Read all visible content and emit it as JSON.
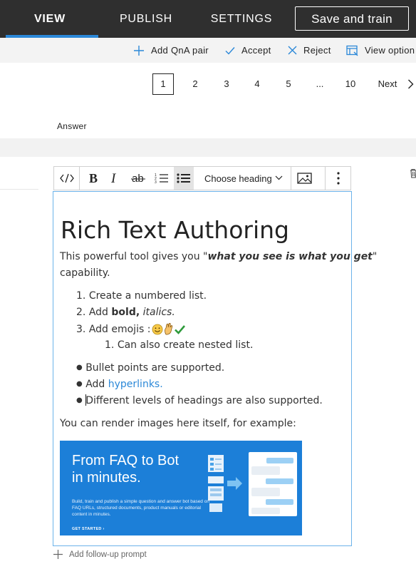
{
  "nav": {
    "tabs": [
      "VIEW",
      "PUBLISH",
      "SETTINGS"
    ],
    "active_tab": "VIEW",
    "save_train_label": "Save and train",
    "accent": "#2b88d8"
  },
  "commands": {
    "add_qna": "Add QnA pair",
    "accept": "Accept",
    "reject": "Reject",
    "view_options": "View option"
  },
  "pagination": {
    "pages": [
      "1",
      "2",
      "3",
      "4",
      "5",
      "...",
      "10"
    ],
    "current": "1",
    "next_label": "Next"
  },
  "answer_header": "Answer",
  "toolbar": {
    "heading_placeholder": "Choose heading",
    "icons": [
      "code-view-icon",
      "bold-icon",
      "italic-icon",
      "strikethrough-icon",
      "numbered-list-icon",
      "bullet-list-icon",
      "image-icon",
      "more-options-icon"
    ]
  },
  "editor": {
    "title": "Rich Text Authoring",
    "intro_prefix": "This powerful tool gives you \"",
    "intro_emphasis": "what you see is what you get",
    "intro_suffix": "\"",
    "intro_line2": "capability.",
    "numbered": {
      "item1": "Create a numbered list.",
      "item2_prefix": "Add ",
      "item2_bold": "bold,",
      "item2_italic": "italics.",
      "item3_prefix": "Add emojis : ",
      "nested_item": "Can also create nested list."
    },
    "bullets": {
      "item1": "Bullet points are supported.",
      "item2_prefix": "Add ",
      "item2_link": "hyperlinks.",
      "item3": "Different levels of headings are also supported."
    },
    "images_line": "You can render images here itself, for example:",
    "banner": {
      "title": "From FAQ to Bot\nin minutes.",
      "description": "Build, train and publish a simple question and answer bot based on FAQ URLs, structured documents, product manuals or editorial content in minutes.",
      "cta": "GET STARTED ›",
      "color": "#1c7fd8"
    }
  },
  "followup_label": "Add follow-up prompt"
}
